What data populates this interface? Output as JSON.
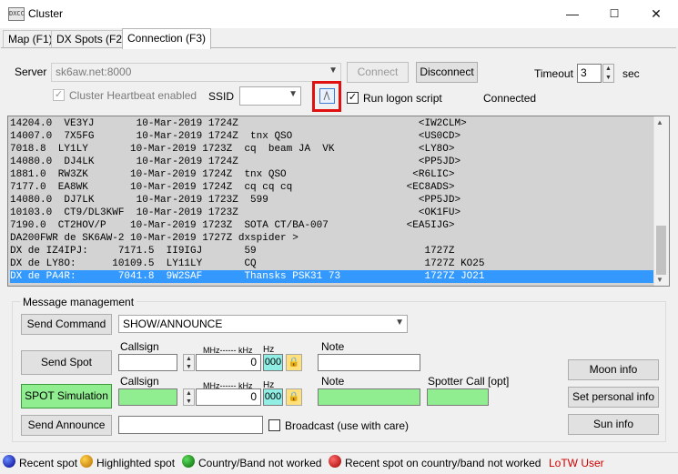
{
  "window": {
    "title": "Cluster",
    "minimize": "—",
    "maximize": "☐",
    "close": "✕",
    "icon_text": "DXCC"
  },
  "tabs": [
    "Map (F1)",
    "DX Spots (F2)",
    "Connection (F3)"
  ],
  "connection": {
    "server_label": "Server",
    "server_value": "sk6aw.net:8000",
    "connect_label": "Connect",
    "disconnect_label": "Disconnect",
    "timeout_label": "Timeout",
    "timeout_value": "3",
    "timeout_unit": "sec",
    "heartbeat_label": "Cluster Heartbeat enabled",
    "ssid_label": "SSID",
    "ssid_value": "",
    "logon_script_label": "Run logon script",
    "status": "Connected"
  },
  "spots": [
    "14204.0  VE3YJ       10-Mar-2019 1724Z                              <IW2CLM>",
    "14007.0  7X5FG       10-Mar-2019 1724Z  tnx QSO                     <US0CD>",
    "7018.8  LY1LY       10-Mar-2019 1723Z  cq  beam JA  VK              <LY8O>",
    "14080.0  DJ4LK       10-Mar-2019 1724Z                              <PP5JD>",
    "1881.0  RW3ZK       10-Mar-2019 1724Z  tnx QSO                     <R6LIC>",
    "7177.0  EA8WK       10-Mar-2019 1724Z  cq cq cq                   <EC8ADS>",
    "14080.0  DJ7LK       10-Mar-2019 1723Z  599                         <PP5JD>",
    "10103.0  CT9/DL3KWF  10-Mar-2019 1723Z                              <OK1FU>",
    "7190.0  CT2HOV/P    10-Mar-2019 1723Z  SOTA CT/BA-007             <EA5IJG>",
    "DA200FWR de SK6AW-2 10-Mar-2019 1727Z dxspider >",
    "DX de IZ4IPJ:     7171.5  II9IGJ       59                            1727Z",
    "DX de LY8O:      10109.5  LY11LY       CQ                            1727Z KO25",
    "DX de PA4R:       7041.8  9W2SAF       Thansks PSK31 73              1727Z JO21"
  ],
  "message": {
    "group_label": "Message management",
    "send_command_label": "Send Command",
    "command_value": "SHOW/ANNOUNCE",
    "send_spot_label": "Send Spot",
    "callsign_label": "Callsign",
    "mhz_khz_label": "MHz------ kHz",
    "hz_label": "Hz",
    "freq_value": "0",
    "hz_value": "000",
    "note_label": "Note",
    "spot_simulation_label": "SPOT Simulation",
    "spotter_label": "Spotter Call [opt]",
    "send_announce_label": "Send Announce",
    "broadcast_label": "Broadcast (use with care)",
    "moon_label": "Moon info",
    "personal_label": "Set personal info",
    "sun_label": "Sun info"
  },
  "legend": {
    "recent": "Recent spot",
    "highlighted": "Highlighted spot",
    "not_worked": "Country/Band not worked",
    "recent_not_worked": "Recent spot on country/band not worked",
    "lotw": "LoTW User"
  },
  "colors": {
    "selection": "#3399ff",
    "green_field": "#90ee90",
    "lotw": "#d00000",
    "highlight_box": "#e01010"
  }
}
